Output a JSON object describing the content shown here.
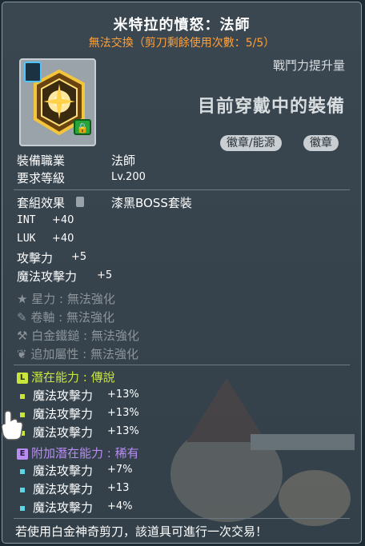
{
  "item": {
    "title": "米特拉的憤怒：法師",
    "subtitle": "無法交換（剪刀剩餘使用次數：5/5）",
    "side_hint": "戰鬥力提升量",
    "equipped_label": "目前穿戴中的裝備",
    "tags": [
      "徽章/能源",
      "徽章"
    ],
    "job_label": "裝備職業",
    "job_value": "法師",
    "level_label": "要求等級",
    "level_value": "Lv.200",
    "set_label": "套組效果",
    "set_value": "漆黑BOSS套裝",
    "stats": [
      {
        "name": "INT",
        "value": "+40"
      },
      {
        "name": "LUK",
        "value": "+40"
      },
      {
        "name": "攻擊力",
        "value": "+5"
      },
      {
        "name": "魔法攻擊力",
        "value": "+5"
      }
    ],
    "upgrades": [
      {
        "icon": "star-icon",
        "name": "星力",
        "value": "無法強化"
      },
      {
        "icon": "scroll-icon",
        "name": "卷軸",
        "value": "無法強化"
      },
      {
        "icon": "hammer-icon",
        "name": "白金鐵鎚",
        "value": "無法強化"
      },
      {
        "icon": "leaf-icon",
        "name": "追加屬性",
        "value": "無法強化"
      }
    ],
    "potential": {
      "badge": "L",
      "label": "潛在能力",
      "grade": "傳說",
      "color": "#c8e63c",
      "lines": [
        {
          "name": "魔法攻擊力",
          "value": "+13%"
        },
        {
          "name": "魔法攻擊力",
          "value": "+13%"
        },
        {
          "name": "魔法攻擊力",
          "value": "+13%"
        }
      ]
    },
    "bonus_potential": {
      "badge": "E",
      "label": "附加潛在能力",
      "grade": "稀有",
      "color": "#b98cf2",
      "bullet_color": "#5fd6e8",
      "lines": [
        {
          "name": "魔法攻擊力",
          "value": "+7%"
        },
        {
          "name": "魔法攻擊力",
          "value": "+13"
        },
        {
          "name": "魔法攻擊力",
          "value": "+4%"
        }
      ]
    },
    "footer": "若使用白金神奇剪刀，該道具可進行一次交易！"
  }
}
